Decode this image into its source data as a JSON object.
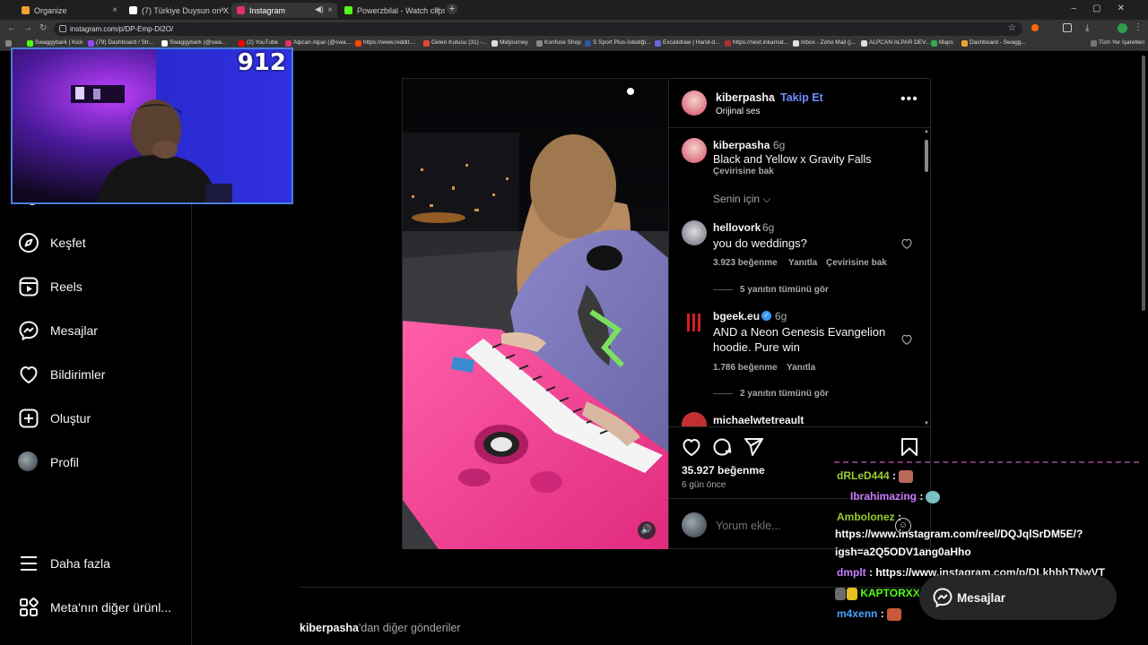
{
  "browser": {
    "tabs": [
      {
        "label": "Organize",
        "color": "#f0a030"
      },
      {
        "label": "(7) Türkiye Duysun on X: \"Esenl...",
        "color": "#ffffff"
      },
      {
        "label": "Instagram",
        "color": "#e1306c"
      },
      {
        "label": "",
        "color": "#888888"
      },
      {
        "label": "Powerzbilal - Watch clips on Ki...",
        "color": "#53fc18"
      }
    ],
    "url": "instagram.com/p/DP-Emp-DI2O/",
    "bookmarks": [
      {
        "label": "Swaggybark | Kick",
        "color": "#53fc18"
      },
      {
        "label": "(79) Dashboard / Str...",
        "color": "#9147ff"
      },
      {
        "label": "Swaggybark (@swa...",
        "color": "#ffffff"
      },
      {
        "label": "(2) YouTube",
        "color": "#ff0000"
      },
      {
        "label": "Alpcan Alpar (@swa...",
        "color": "#e1306c"
      },
      {
        "label": "https://www.reddit....",
        "color": "#ff4500"
      },
      {
        "label": "Gelen Kutusu (31) -...",
        "color": "#ea4335"
      },
      {
        "label": "Midjourney",
        "color": "#dddddd"
      },
      {
        "label": "Konfuse Shop",
        "color": "#888888"
      },
      {
        "label": "S Sport Plus-İstediği...",
        "color": "#3355aa"
      },
      {
        "label": "Excalidraw | Hand-d...",
        "color": "#6965db"
      },
      {
        "label": "https://next.inkarnat...",
        "color": "#aa3333"
      },
      {
        "label": "Inbox - Zoho Mail (j...",
        "color": "#e0e0e0"
      },
      {
        "label": "ALPCAN ALPAR DEV...",
        "color": "#dddddd"
      },
      {
        "label": "Maps",
        "color": "#34a853"
      },
      {
        "label": "Dashboard - Swagg...",
        "color": "#f0a030"
      }
    ],
    "all_bookmarks": "Tüm Yer İşaretleri"
  },
  "sidebar": {
    "items": [
      {
        "label": "Keşfet",
        "icon": "compass-icon"
      },
      {
        "label": "Reels",
        "icon": "reels-icon"
      },
      {
        "label": "Mesajlar",
        "icon": "messenger-icon"
      },
      {
        "label": "Bildirimler",
        "icon": "heart-icon"
      },
      {
        "label": "Oluştur",
        "icon": "plus-square-icon"
      },
      {
        "label": "Profil",
        "icon": "avatar"
      }
    ],
    "more": "Daha fazla",
    "meta": "Meta'nın diğer ürünl..."
  },
  "webcam": {
    "counter": "912"
  },
  "post": {
    "author": "kiberpasha",
    "follow": "Takip Et",
    "audio": "Orijinal ses",
    "caption_time": "6g",
    "caption": "Black and Yellow x Gravity Falls",
    "translate": "Çevirisine bak",
    "for_you": "Senin için",
    "comments": [
      {
        "user": "hellovork",
        "time": "6g",
        "text": "you do weddings?",
        "likes": "3.923 beğenme",
        "reply": "Yanıtla",
        "translate": "Çevirisine bak",
        "view_replies": "5 yanıtın tümünü gör"
      },
      {
        "user": "bgeek.eu",
        "time": "6g",
        "text": "AND a Neon Genesis Evangelion hoodie. Pure win",
        "likes": "1.786 beğenme",
        "reply": "Yanıtla",
        "view_replies": "2 yanıtın tümünü gör"
      },
      {
        "user": "michaelwtetreault"
      }
    ],
    "like_count": "35.927 beğenme",
    "posted": "6 gün önce",
    "comment_placeholder": "Yorum ekle..."
  },
  "more_posts": {
    "user": "kiberpasha",
    "suffix": "'dan diğer gönderiler"
  },
  "chat": [
    {
      "user": "dRLeD444",
      "text": "",
      "color": "#9acd32"
    },
    {
      "user": "Ibrahimazing",
      "text": "",
      "color": "#c77dff"
    },
    {
      "user": "Ambolonez",
      "text": "https://www.instagram.com/reel/DQJqlSrDM5E/?",
      "color": "#9acd32"
    },
    {
      "user": "",
      "text": "igsh=a2Q5ODV1ang0aHho",
      "color": "#ffffff"
    },
    {
      "user": "dmplt",
      "text": "https://www.instagram.com/p/DLkhbhTNwVT",
      "color": "#c77dff"
    },
    {
      "user": "KAPTORXX",
      "text": "",
      "color": "#53fc18"
    },
    {
      "user": "m4xenn",
      "text": "",
      "color": "#4aa3ff"
    }
  ],
  "messages_pill": "Mesajlar"
}
